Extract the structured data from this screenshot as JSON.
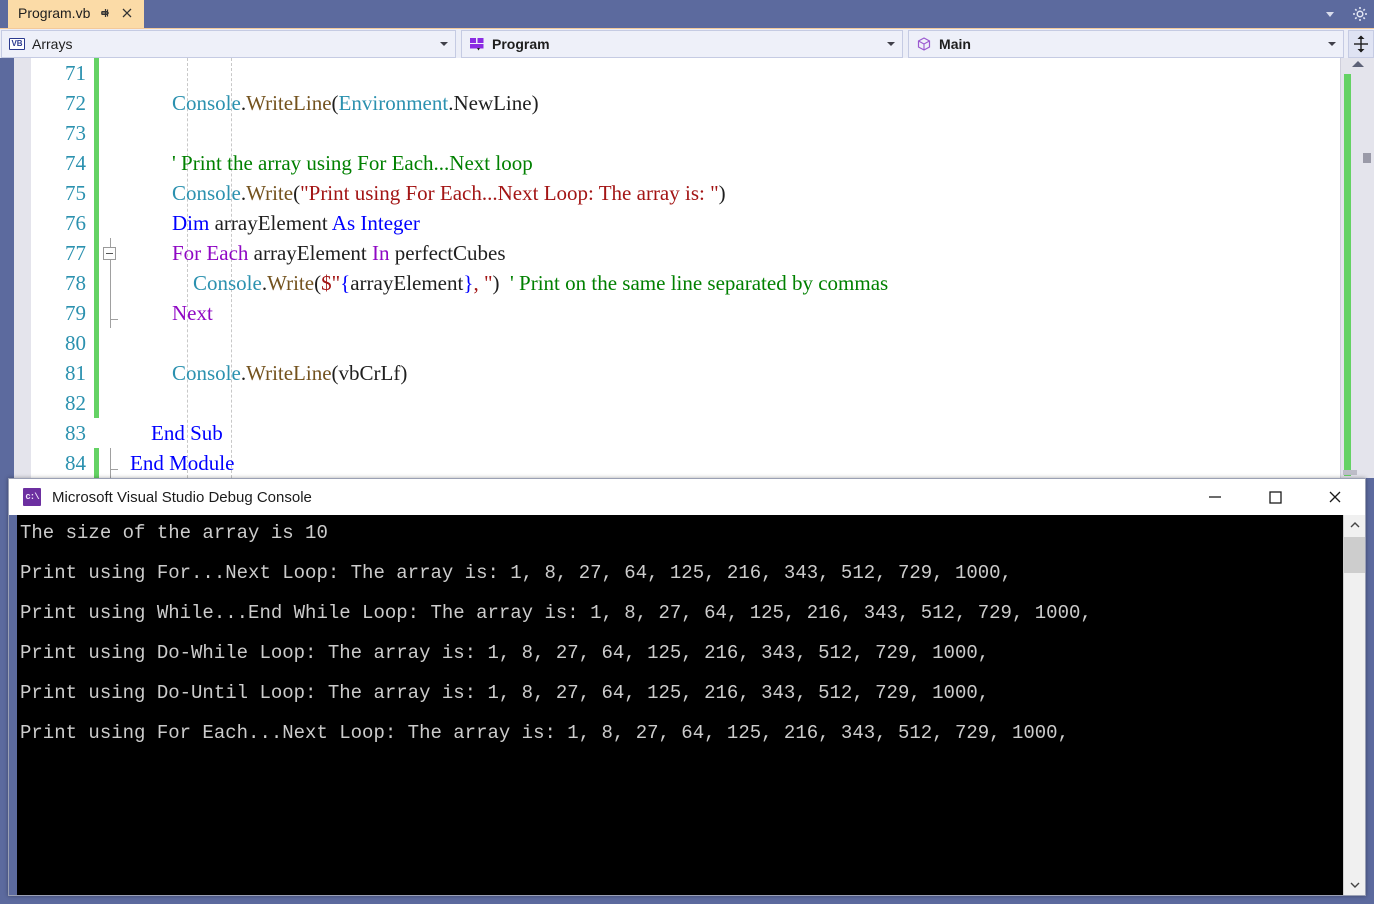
{
  "window": {
    "ide_name": "Visual Studio",
    "tab": {
      "title": "Program.vb",
      "pin_icon": "pin-icon",
      "close_icon": "close-icon"
    },
    "tabstrip_right": {
      "overflow_icon": "chevron-down-icon",
      "settings_icon": "gear-icon"
    }
  },
  "navbar": {
    "project_combo": {
      "icon": "vb-project-icon",
      "icon_label": "VB",
      "value": "Arrays",
      "arrow_icon": "chevron-down-icon"
    },
    "type_combo": {
      "icon": "module-icon",
      "value": "Program",
      "arrow_icon": "chevron-down-icon"
    },
    "member_combo": {
      "icon": "method-icon",
      "value": "Main",
      "arrow_icon": "chevron-down-icon"
    },
    "split_button": {
      "icon": "split-window-icon"
    }
  },
  "editor": {
    "language": "Visual Basic",
    "first_line_number": 71,
    "outline_collapse_icon": "minus-box-icon",
    "lines": [
      {
        "num": "71",
        "changed": true,
        "tokens": []
      },
      {
        "num": "72",
        "changed": true,
        "tokens": [
          {
            "t": "        ",
            "c": "t-pl"
          },
          {
            "t": "Console",
            "c": "t-cls"
          },
          {
            "t": ".",
            "c": "t-pl"
          },
          {
            "t": "WriteLine",
            "c": "t-mem"
          },
          {
            "t": "(",
            "c": "t-pl"
          },
          {
            "t": "Environment",
            "c": "t-cls"
          },
          {
            "t": ".NewLine)",
            "c": "t-pl"
          }
        ]
      },
      {
        "num": "73",
        "changed": true,
        "tokens": []
      },
      {
        "num": "74",
        "changed": true,
        "tokens": [
          {
            "t": "        ",
            "c": "t-pl"
          },
          {
            "t": "' Print the array using For Each...Next loop",
            "c": "t-cmt"
          }
        ]
      },
      {
        "num": "75",
        "changed": true,
        "tokens": [
          {
            "t": "        ",
            "c": "t-pl"
          },
          {
            "t": "Console",
            "c": "t-cls"
          },
          {
            "t": ".",
            "c": "t-pl"
          },
          {
            "t": "Write",
            "c": "t-mem"
          },
          {
            "t": "(",
            "c": "t-pl"
          },
          {
            "t": "\"Print using For Each...Next Loop: The array is: \"",
            "c": "t-str"
          },
          {
            "t": ")",
            "c": "t-pl"
          }
        ]
      },
      {
        "num": "76",
        "changed": true,
        "tokens": [
          {
            "t": "        ",
            "c": "t-pl"
          },
          {
            "t": "Dim",
            "c": "t-kw"
          },
          {
            "t": " arrayElement ",
            "c": "t-pl"
          },
          {
            "t": "As Integer",
            "c": "t-kw"
          }
        ]
      },
      {
        "num": "77",
        "changed": true,
        "outline": "collapse",
        "tokens": [
          {
            "t": "        ",
            "c": "t-pl"
          },
          {
            "t": "For Each",
            "c": "t-ctl"
          },
          {
            "t": " arrayElement ",
            "c": "t-pl"
          },
          {
            "t": "In",
            "c": "t-ctl"
          },
          {
            "t": " perfectCubes",
            "c": "t-pl"
          }
        ]
      },
      {
        "num": "78",
        "changed": true,
        "tokens": [
          {
            "t": "            ",
            "c": "t-pl"
          },
          {
            "t": "Console",
            "c": "t-cls"
          },
          {
            "t": ".",
            "c": "t-pl"
          },
          {
            "t": "Write",
            "c": "t-mem"
          },
          {
            "t": "(",
            "c": "t-pl"
          },
          {
            "t": "$\"",
            "c": "t-str"
          },
          {
            "t": "{",
            "c": "t-brace"
          },
          {
            "t": "arrayElement",
            "c": "t-pl"
          },
          {
            "t": "}",
            "c": "t-brace"
          },
          {
            "t": ", \"",
            "c": "t-str"
          },
          {
            "t": ")",
            "c": "t-pl"
          },
          {
            "t": "  ",
            "c": "t-pl"
          },
          {
            "t": "' Print on the same line separated by commas",
            "c": "t-cmt"
          }
        ]
      },
      {
        "num": "79",
        "changed": true,
        "outline": "end",
        "tokens": [
          {
            "t": "        ",
            "c": "t-pl"
          },
          {
            "t": "Next",
            "c": "t-ctl"
          }
        ]
      },
      {
        "num": "80",
        "changed": true,
        "tokens": []
      },
      {
        "num": "81",
        "changed": true,
        "tokens": [
          {
            "t": "        ",
            "c": "t-pl"
          },
          {
            "t": "Console",
            "c": "t-cls"
          },
          {
            "t": ".",
            "c": "t-pl"
          },
          {
            "t": "WriteLine",
            "c": "t-mem"
          },
          {
            "t": "(vbCrLf)",
            "c": "t-pl"
          }
        ]
      },
      {
        "num": "82",
        "changed": true,
        "tokens": []
      },
      {
        "num": "83",
        "changed": false,
        "tokens": [
          {
            "t": "    ",
            "c": "t-pl"
          },
          {
            "t": "End Sub",
            "c": "t-kw"
          }
        ]
      },
      {
        "num": "84",
        "changed": true,
        "outline": "end",
        "tokens": [
          {
            "t": "End Module",
            "c": "t-kw"
          }
        ]
      }
    ],
    "scrollbar": {
      "up_arrow_icon": "scroll-up-arrow-icon",
      "change_marker_color": "#64d264",
      "position_marker_icon": "scroll-marker-icon"
    }
  },
  "console": {
    "title": "Microsoft Visual Studio Debug Console",
    "app_icon": "console-app-icon",
    "app_icon_glyph": "c:\\",
    "controls": {
      "minimize_icon": "minimize-icon",
      "maximize_icon": "maximize-icon",
      "close_icon": "close-icon"
    },
    "output_lines": [
      "The size of the array is 10",
      "",
      "Print using For...Next Loop: The array is: 1, 8, 27, 64, 125, 216, 343, 512, 729, 1000,",
      "",
      "Print using While...End While Loop: The array is: 1, 8, 27, 64, 125, 216, 343, 512, 729, 1000,",
      "",
      "Print using Do-While Loop: The array is: 1, 8, 27, 64, 125, 216, 343, 512, 729, 1000,",
      "",
      "Print using Do-Until Loop: The array is: 1, 8, 27, 64, 125, 216, 343, 512, 729, 1000,",
      "",
      "Print using For Each...Next Loop: The array is: 1, 8, 27, 64, 125, 216, 343, 512, 729, 1000,"
    ],
    "array_values": [
      1,
      8,
      27,
      64,
      125,
      216,
      343,
      512,
      729,
      1000
    ],
    "array_size": 10,
    "scrollbar": {
      "up_arrow_icon": "chevron-up-icon",
      "down_arrow_icon": "chevron-down-icon",
      "thumb_icon": "scrollbar-thumb"
    }
  },
  "colors": {
    "shell_background": "#5c6a9e",
    "active_tab": "#fbdba7",
    "change_bar": "#64d264",
    "line_number": "#2b91af",
    "console_background": "#000000",
    "console_text": "#cccccc"
  }
}
